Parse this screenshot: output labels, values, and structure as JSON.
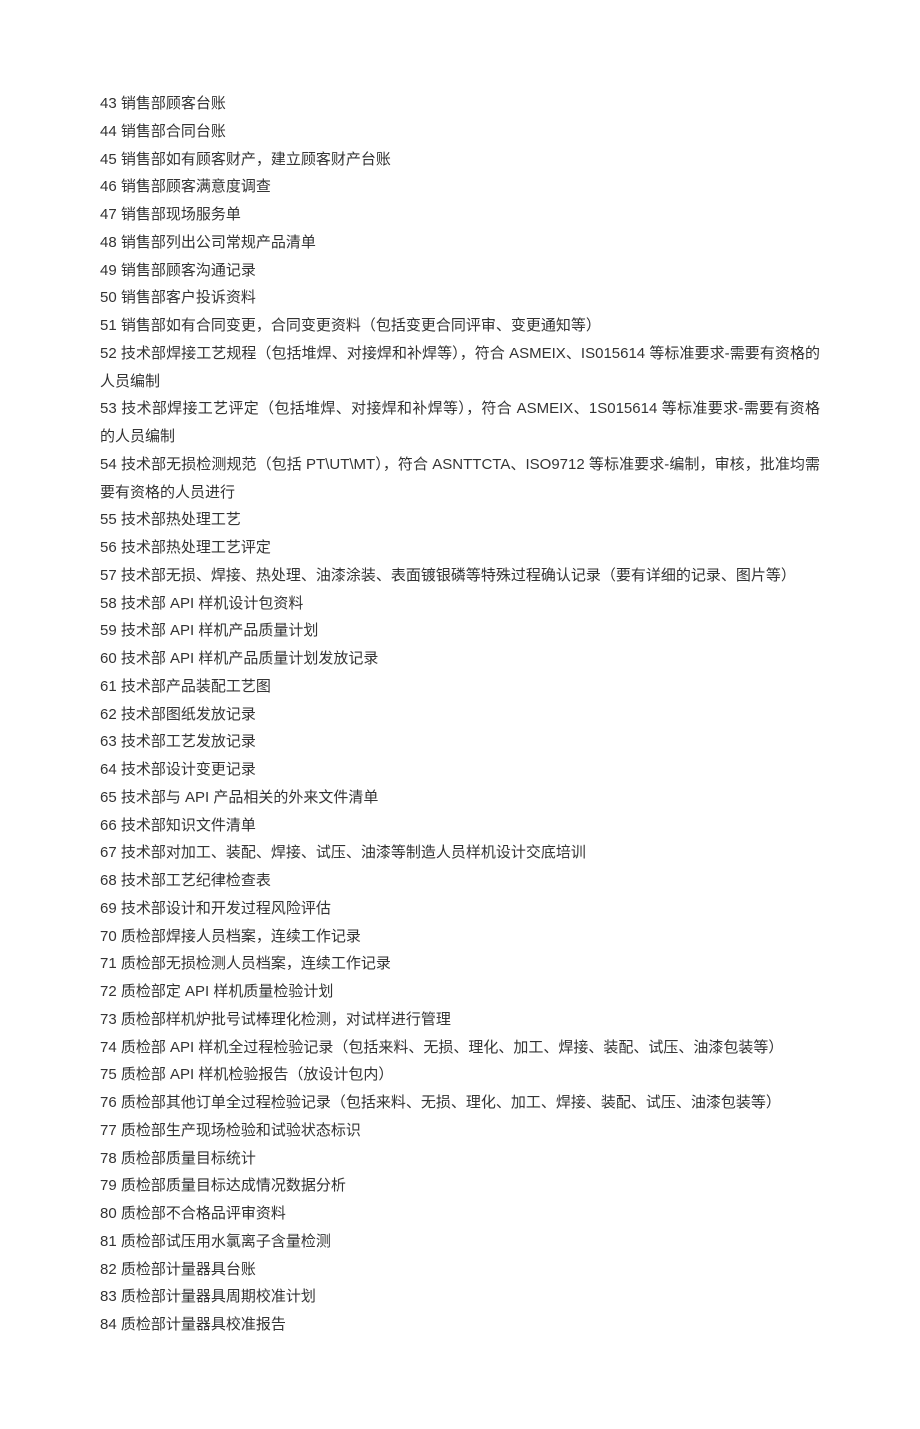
{
  "items": [
    {
      "num": "43",
      "text": "销售部顾客台账"
    },
    {
      "num": "44",
      "text": "销售部合同台账"
    },
    {
      "num": "45",
      "text": "销售部如有顾客财产，建立顾客财产台账"
    },
    {
      "num": "46",
      "text": "销售部顾客满意度调查"
    },
    {
      "num": "47",
      "text": "销售部现场服务单"
    },
    {
      "num": "48",
      "text": "销售部列出公司常规产品清单"
    },
    {
      "num": "49",
      "text": "销售部顾客沟通记录"
    },
    {
      "num": "50",
      "text": "销售部客户投诉资料"
    },
    {
      "num": "51",
      "text": "销售部如有合同变更，合同变更资料（包括变更合同评审、变更通知等）"
    },
    {
      "num": "52",
      "text": "技术部焊接工艺规程（包括堆焊、对接焊和补焊等），符合 ASMEIX、IS015614 等标准要求-需要有资格的人员编制"
    },
    {
      "num": "53",
      "text": "技术部焊接工艺评定（包括堆焊、对接焊和补焊等），符合 ASMEIX、1S015614 等标准要求-需要有资格的人员编制"
    },
    {
      "num": "54",
      "text": "技术部无损检测规范（包括 PT\\UT\\MT），符合 ASNTTCTA、ISO9712 等标准要求-编制，审核，批准均需要有资格的人员进行"
    },
    {
      "num": "55",
      "text": "技术部热处理工艺"
    },
    {
      "num": "56",
      "text": "技术部热处理工艺评定"
    },
    {
      "num": "57",
      "text": "技术部无损、焊接、热处理、油漆涂装、表面镀银磷等特殊过程确认记录（要有详细的记录、图片等）"
    },
    {
      "num": "58",
      "text": "技术部 API 样机设计包资料"
    },
    {
      "num": "59",
      "text": "技术部 API 样机产品质量计划"
    },
    {
      "num": "60",
      "text": "技术部 API 样机产品质量计划发放记录"
    },
    {
      "num": "61",
      "text": "技术部产品装配工艺图"
    },
    {
      "num": "62",
      "text": "技术部图纸发放记录"
    },
    {
      "num": "63",
      "text": "技术部工艺发放记录"
    },
    {
      "num": "64",
      "text": "技术部设计变更记录"
    },
    {
      "num": "65",
      "text": "技术部与 API 产品相关的外来文件清单"
    },
    {
      "num": "66",
      "text": "技术部知识文件清单"
    },
    {
      "num": "67",
      "text": "技术部对加工、装配、焊接、试压、油漆等制造人员样机设计交底培训"
    },
    {
      "num": "68",
      "text": "技术部工艺纪律检查表"
    },
    {
      "num": "69",
      "text": "技术部设计和开发过程风险评估"
    },
    {
      "num": "70",
      "text": "质检部焊接人员档案，连续工作记录"
    },
    {
      "num": "71",
      "text": "质检部无损检测人员档案，连续工作记录"
    },
    {
      "num": "72",
      "text": "质检部定 API 样机质量检验计划"
    },
    {
      "num": "73",
      "text": "质检部样机炉批号试棒理化检测，对试样进行管理"
    },
    {
      "num": "74",
      "text": "质检部 API 样机全过程检验记录（包括来料、无损、理化、加工、焊接、装配、试压、油漆包装等）"
    },
    {
      "num": "75",
      "text": "质检部 API 样机检验报告（放设计包内）"
    },
    {
      "num": "76",
      "text": "质检部其他订单全过程检验记录（包括来料、无损、理化、加工、焊接、装配、试压、油漆包装等）"
    },
    {
      "num": "77",
      "text": "质检部生产现场检验和试验状态标识"
    },
    {
      "num": "78",
      "text": "质检部质量目标统计"
    },
    {
      "num": "79",
      "text": "质检部质量目标达成情况数据分析"
    },
    {
      "num": "80",
      "text": "质检部不合格品评审资料"
    },
    {
      "num": "81",
      "text": "质检部试压用水氯离子含量检测"
    },
    {
      "num": "82",
      "text": "质检部计量器具台账"
    },
    {
      "num": "83",
      "text": "质检部计量器具周期校准计划"
    },
    {
      "num": "84",
      "text": "质检部计量器具校准报告"
    }
  ]
}
